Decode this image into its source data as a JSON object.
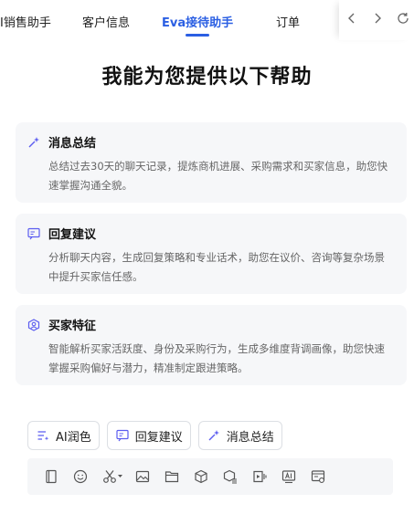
{
  "tabs": [
    {
      "label": "I销售助手"
    },
    {
      "label": "客户信息"
    },
    {
      "label": "Eva接待助手",
      "active": true
    },
    {
      "label": "订单"
    }
  ],
  "nav_icons": [
    "chevron-left-icon",
    "chevron-right-icon",
    "refresh-icon"
  ],
  "page_title": "我能为您提供以下帮助",
  "cards": [
    {
      "icon": "ai-sparkle-icon",
      "title": "消息总结",
      "desc": "总结过去30天的聊天记录，提炼商机进展、采购需求和买家信息，助您快速掌握沟通全貌。"
    },
    {
      "icon": "reply-ai-icon",
      "title": "回复建议",
      "desc": "分析聊天内容，生成回复策略和专业话术，助您在议价、咨询等复杂场景中提升买家信任感。"
    },
    {
      "icon": "buyer-profile-icon",
      "title": "买家特征",
      "desc": "智能解析买家活跃度、身份及采购行为，生成多维度背调画像，助您快速掌握采购偏好与潜力，精准制定跟进策略。"
    }
  ],
  "quick_actions": [
    {
      "icon": "polish-icon",
      "label": "AI润色"
    },
    {
      "icon": "reply-ai-icon",
      "label": "回复建议"
    },
    {
      "icon": "ai-sparkle-icon",
      "label": "消息总结"
    }
  ],
  "toolbar_icons": [
    "phrase-book-icon",
    "emoji-icon",
    "scissors-icon",
    "image-icon",
    "folder-icon",
    "product-cube-icon",
    "product-list-icon",
    "video-icon",
    "ai-text-icon",
    "order-card-icon"
  ],
  "colors": {
    "accent": "#2b5fe3",
    "icon_purple": "#5b5cf0",
    "card_bg": "#f6f7f9"
  }
}
